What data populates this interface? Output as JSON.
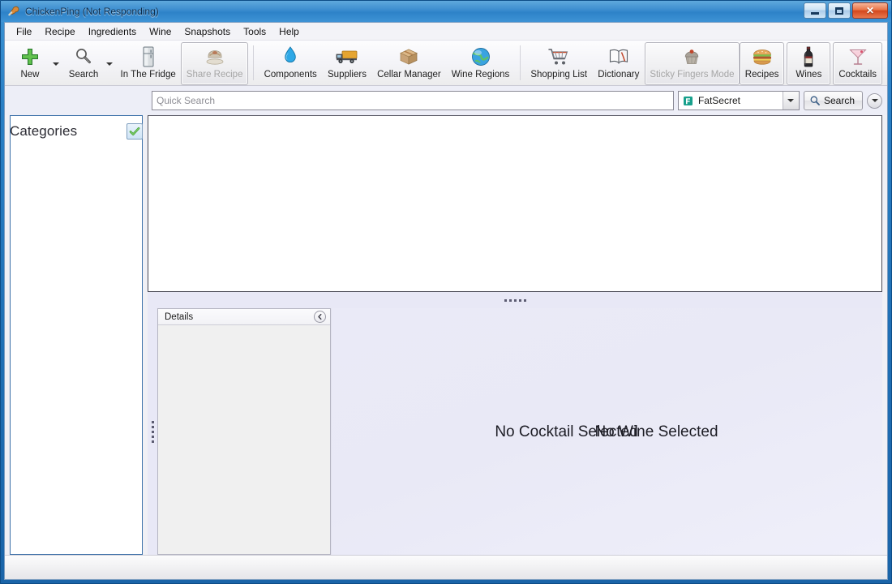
{
  "window": {
    "title": "ChickenPing (Not Responding)",
    "app_icon": "chicken-drumstick-icon",
    "minimize_label": "Minimize",
    "maximize_label": "Maximize",
    "close_label": "Close",
    "accent_color": "#2d82c8",
    "panel_background": "#e8e8f6"
  },
  "menu": {
    "items": [
      {
        "label": "File"
      },
      {
        "label": "Recipe"
      },
      {
        "label": "Ingredients"
      },
      {
        "label": "Wine"
      },
      {
        "label": "Snapshots"
      },
      {
        "label": "Tools"
      },
      {
        "label": "Help"
      }
    ]
  },
  "toolbar": {
    "items": [
      {
        "label": "New",
        "icon": "plus-icon",
        "has_dropdown": true,
        "enabled": true,
        "framed": false
      },
      {
        "label": "Search",
        "icon": "magnifier-icon",
        "has_dropdown": true,
        "enabled": true,
        "framed": false
      },
      {
        "label": "In The Fridge",
        "icon": "fridge-icon",
        "has_dropdown": false,
        "enabled": true,
        "framed": false
      },
      {
        "label": "Share Recipe",
        "icon": "share-recipe-icon",
        "has_dropdown": false,
        "enabled": false,
        "framed": true
      },
      {
        "label": "Components",
        "icon": "water-drop-icon",
        "has_dropdown": false,
        "enabled": true,
        "framed": false
      },
      {
        "label": "Suppliers",
        "icon": "truck-icon",
        "has_dropdown": false,
        "enabled": true,
        "framed": false
      },
      {
        "label": "Cellar Manager",
        "icon": "box-icon",
        "has_dropdown": false,
        "enabled": true,
        "framed": false
      },
      {
        "label": "Wine Regions",
        "icon": "globe-icon",
        "has_dropdown": false,
        "enabled": true,
        "framed": false
      },
      {
        "label": "Shopping List",
        "icon": "shopping-cart-icon",
        "has_dropdown": false,
        "enabled": true,
        "framed": false
      },
      {
        "label": "Dictionary",
        "icon": "book-icon",
        "has_dropdown": false,
        "enabled": true,
        "framed": false
      },
      {
        "label": "Sticky Fingers Mode",
        "icon": "muffin-icon",
        "has_dropdown": false,
        "enabled": false,
        "framed": true
      }
    ],
    "mode_buttons": [
      {
        "label": "Recipes",
        "icon": "burger-icon",
        "selected": true
      },
      {
        "label": "Wines",
        "icon": "wine-bottle-icon",
        "selected": false
      },
      {
        "label": "Cocktails",
        "icon": "martini-glass-icon",
        "selected": false
      }
    ]
  },
  "search": {
    "placeholder": "Quick Search",
    "value": "",
    "provider": "FatSecret",
    "provider_icon": "fatsecret-icon",
    "search_button_label": "Search",
    "search_button_icon": "magnifier-icon",
    "overflow_icon": "chevron-down-icon"
  },
  "categories": {
    "title": "Categories",
    "toggle_icon": "green-check-icon",
    "items": []
  },
  "results": {
    "items": []
  },
  "details": {
    "title": "Details",
    "collapse_icon": "chevron-left-icon",
    "content": ""
  },
  "preview": {
    "cocktail_placeholder": "No Cocktail Selected",
    "wine_placeholder": "No Wine Selected"
  },
  "splitters": {
    "horizontal_handle": "horizontal-splitter",
    "vertical_handle": "vertical-splitter"
  },
  "statusbar": {
    "text": ""
  }
}
